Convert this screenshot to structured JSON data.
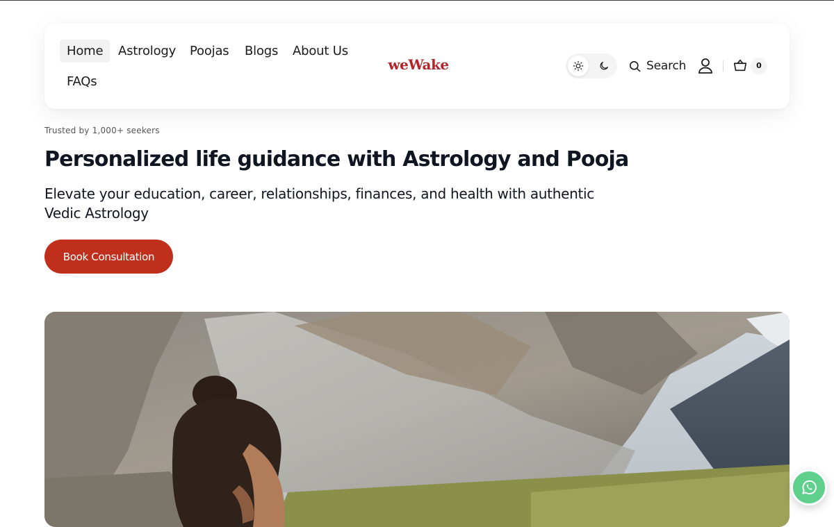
{
  "nav": {
    "items": [
      {
        "label": "Home",
        "active": true
      },
      {
        "label": "Astrology",
        "active": false
      },
      {
        "label": "Poojas",
        "active": false
      },
      {
        "label": "Blogs",
        "active": false
      },
      {
        "label": "About Us",
        "active": false
      },
      {
        "label": "FAQs",
        "active": false
      }
    ]
  },
  "brand": {
    "logo_text": "weWake",
    "color": "#b0262c"
  },
  "header_actions": {
    "theme_light_icon": "sun-icon",
    "theme_dark_icon": "moon-icon",
    "search_label": "Search",
    "account_icon": "user-icon",
    "cart_icon": "basket-icon",
    "cart_count": "0"
  },
  "hero": {
    "trusted_text": "Trusted by 1,000+ seekers",
    "headline": "Personalized life guidance with Astrology and Pooja",
    "subheadline": "Elevate your education, career, relationships, finances, and health with authentic Vedic Astrology",
    "cta_label": "Book Consultation",
    "cta_color": "#bf2f1c",
    "image_subject": "man meditating in Himalayan mountain valley"
  },
  "floating": {
    "whatsapp_icon": "whatsapp-icon",
    "color": "#5fd08b"
  }
}
